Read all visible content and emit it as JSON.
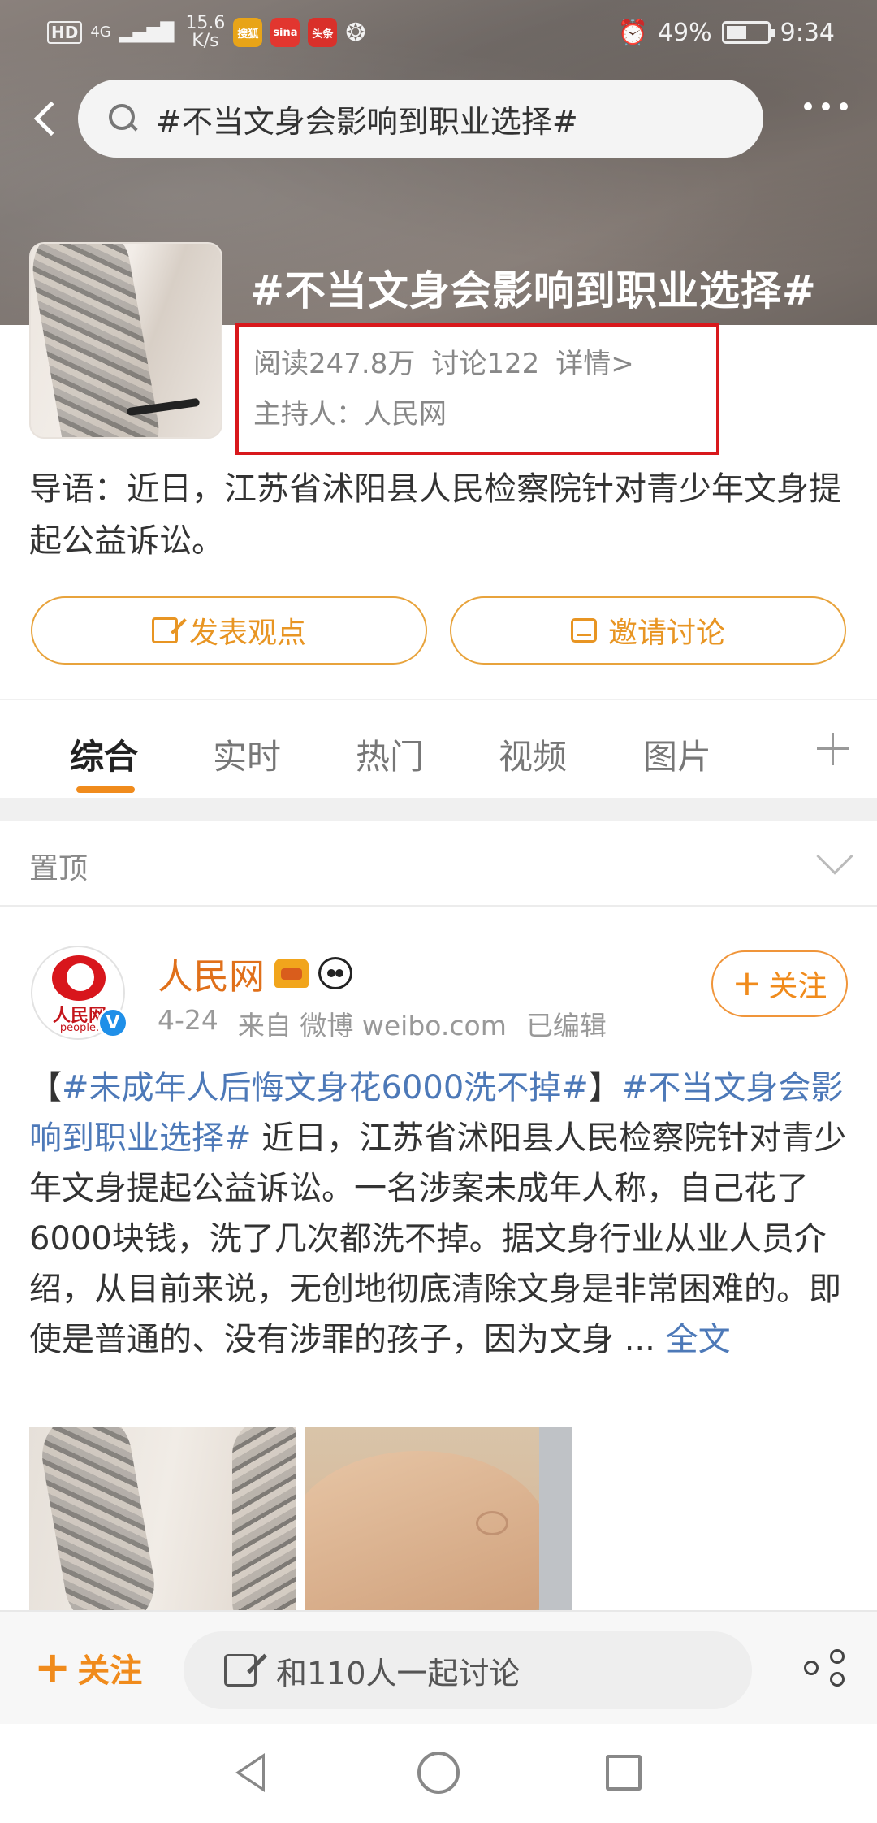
{
  "status_bar": {
    "hd": "HD",
    "network": "4G",
    "speed_value": "15.6",
    "speed_unit": "K/s",
    "apps": [
      "搜狐",
      "sina",
      "头条"
    ],
    "battery": "49%",
    "time": "9:34"
  },
  "search": {
    "query": "#不当文身会影响到职业选择#"
  },
  "topic": {
    "title": "#不当文身会影响到职业选择#",
    "reads": "阅读247.8万",
    "discussions": "讨论122",
    "details_link": "详情>",
    "host_label": "主持人：",
    "host_name": "人民网",
    "intro": "导语：近日，江苏省沭阳县人民检察院针对青少年文身提起公益诉讼。",
    "post_opinion_label": "发表观点",
    "invite_label": "邀请讨论"
  },
  "tabs": [
    "综合",
    "实时",
    "热门",
    "视频",
    "图片"
  ],
  "pinned": {
    "label": "置顶"
  },
  "post": {
    "author": "人民网",
    "avatar_text": "人民网",
    "avatar_sub": "people.",
    "verified_badge": "V",
    "date": "4-24",
    "source": "来自 微博 weibo.com",
    "edited": "已编辑",
    "follow_label": "关注",
    "body_open_bracket": "【",
    "hashtag1": "#未成年人后悔文身花6000洗不掉#",
    "body_close_bracket": "】",
    "hashtag2": "#不当文身会影响到职业选择#",
    "body_text": " 近日，江苏省沭阳县人民检察院针对青少年文身提起公益诉讼。一名涉案未成年人称，自己花了6000块钱，洗了几次都洗不掉。据文身行业从业人员介绍，从目前来说，无创地彻底清除文身是非常困难的。即使是普通的、没有涉罪的孩子，因为文身 ... ",
    "full_text_link": "全文"
  },
  "bottom_bar": {
    "follow_label": "关注",
    "input_placeholder": "和110人一起讨论"
  },
  "colors": {
    "accent_orange": "#f08b1c",
    "link_blue": "#4d79b8",
    "highlight_red": "#d8181c"
  }
}
